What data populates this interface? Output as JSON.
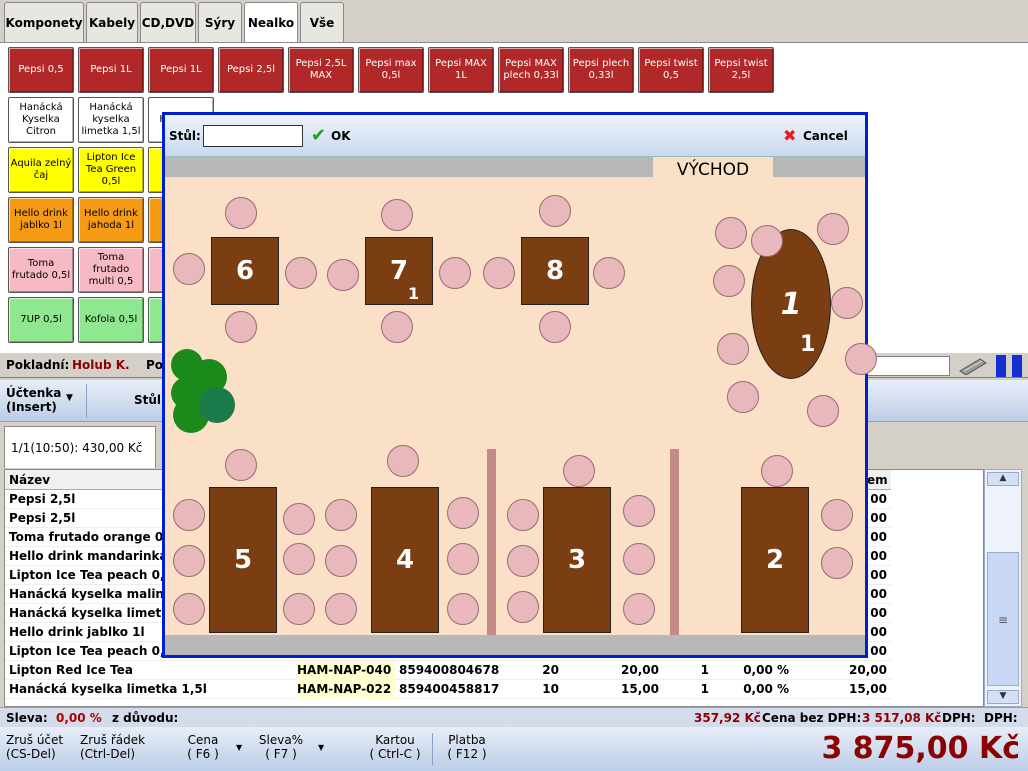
{
  "tabs": [
    "Komponety",
    "Kabely",
    "CD,DVD",
    "Sýry",
    "Nealko",
    "Vše"
  ],
  "products": {
    "row1": [
      "Pepsi 0,5",
      "Pepsi 1L",
      "Pepsi 1L",
      "Pepsi 2,5l",
      "Pepsi 2,5L MAX",
      "Pepsi max 0,5l",
      "Pepsi MAX 1L",
      "Pepsi MAX plech 0,33l",
      "Pepsi plech 0,33l",
      "Pepsi twist 0,5",
      "Pepsi twist 2,5l"
    ],
    "row2": [
      "Hanácká Kyselka Citron",
      "Hanácká kyselka limetka 1,5l",
      "Hanácká"
    ],
    "row3": [
      "Aquila zelný čaj",
      "Lipton Ice Tea Green 0,5l",
      "L T"
    ],
    "row4": [
      "Hello drink jablko 1l",
      "Hello drink jahoda 1l",
      "H m"
    ],
    "row5": [
      "Toma frutado 0,5l",
      "Toma frutado multi 0,5",
      "c"
    ],
    "row6": [
      "7UP 0,5l",
      "Kofola 0,5l",
      ""
    ]
  },
  "info": {
    "cashier_label": "Pokladní:",
    "cashier_name": "Holub K.",
    "po_label": "Po"
  },
  "toolbar": {
    "receipt_label": "Účtenka\n(Insert)",
    "table_label": "Stůl"
  },
  "order_tab": "1/1(10:50): 430,00 Kč",
  "grid_header": {
    "name": "Název",
    "last": "em"
  },
  "rows": [
    {
      "name": "Pepsi 2,5l",
      "code": "",
      "ean": "",
      "qty": "",
      "price": "",
      "n": "",
      "disc": "",
      "total": "00"
    },
    {
      "name": "Pepsi 2,5l",
      "code": "",
      "ean": "",
      "qty": "",
      "price": "",
      "n": "",
      "disc": "",
      "total": "00"
    },
    {
      "name": "Toma frutado orange 0,5",
      "code": "",
      "ean": "",
      "qty": "",
      "price": "",
      "n": "",
      "disc": "",
      "total": "00"
    },
    {
      "name": "Hello drink mandarinka 1",
      "code": "",
      "ean": "",
      "qty": "",
      "price": "",
      "n": "",
      "disc": "",
      "total": "00"
    },
    {
      "name": "Lipton Ice Tea peach 0,5",
      "code": "",
      "ean": "",
      "qty": "",
      "price": "",
      "n": "",
      "disc": "",
      "total": "00"
    },
    {
      "name": "Hanácká kyselka malina 1",
      "code": "",
      "ean": "",
      "qty": "",
      "price": "",
      "n": "",
      "disc": "",
      "total": "00"
    },
    {
      "name": "Hanácká kyselka limetka",
      "code": "",
      "ean": "",
      "qty": "",
      "price": "",
      "n": "",
      "disc": "",
      "total": "00"
    },
    {
      "name": "Hello drink jablko 1l",
      "code": "",
      "ean": "",
      "qty": "",
      "price": "",
      "n": "",
      "disc": "",
      "total": "00"
    },
    {
      "name": "Lipton Ice Tea peach 0,5",
      "code": "",
      "ean": "",
      "qty": "",
      "price": "",
      "n": "",
      "disc": "",
      "total": "00"
    },
    {
      "name": "Lipton Red Ice Tea",
      "code": "HAM-NAP-040",
      "ean": "859400804678",
      "qty": "20",
      "price": "20,00",
      "n": "1",
      "disc": "0,00 %",
      "total": "20,00"
    },
    {
      "name": "Hanácká kyselka limetka 1,5l",
      "code": "HAM-NAP-022",
      "ean": "859400458817",
      "qty": "10",
      "price": "15,00",
      "n": "1",
      "disc": "0,00 %",
      "total": "15,00"
    }
  ],
  "summary": {
    "discount_label": "Sleva:",
    "discount_value": "0,00 %",
    "reason_label": "z důvodu:",
    "vat_amount": "357,92 Kč",
    "novat_label": "Cena bez DPH:",
    "novat_value": "3 517,08 Kč",
    "dph1": "DPH:",
    "dph2": "DPH:"
  },
  "bottom": {
    "b1": "Zruš účet\n(CS-Del)",
    "b2": "Zruš řádek\n(Ctrl-Del)",
    "b3": "Cena\n( F6 )",
    "b4": "Sleva%\n( F7 )",
    "b5": "Kartou\n( Ctrl-C )",
    "b6": "Platba\n( F12 )",
    "total": "3 875,00 Kč"
  },
  "dialog": {
    "table_label": "Stůl:",
    "table_value": "",
    "ok_label": "OK",
    "cancel_label": "Cancel",
    "direction": "VÝCHOD",
    "tables": {
      "t1": "1",
      "t1_sub": "1",
      "t2": "2",
      "t3": "3",
      "t4": "4",
      "t5": "5",
      "t6": "6",
      "t7": "7",
      "t7_sub": "1",
      "t8": "8"
    }
  },
  "colors": {
    "accent_red": "#b02828",
    "total_red": "#8b0000",
    "dialog_border": "#0020d0",
    "floor": "#fbe0c8",
    "table_wood": "#7a3e12"
  }
}
